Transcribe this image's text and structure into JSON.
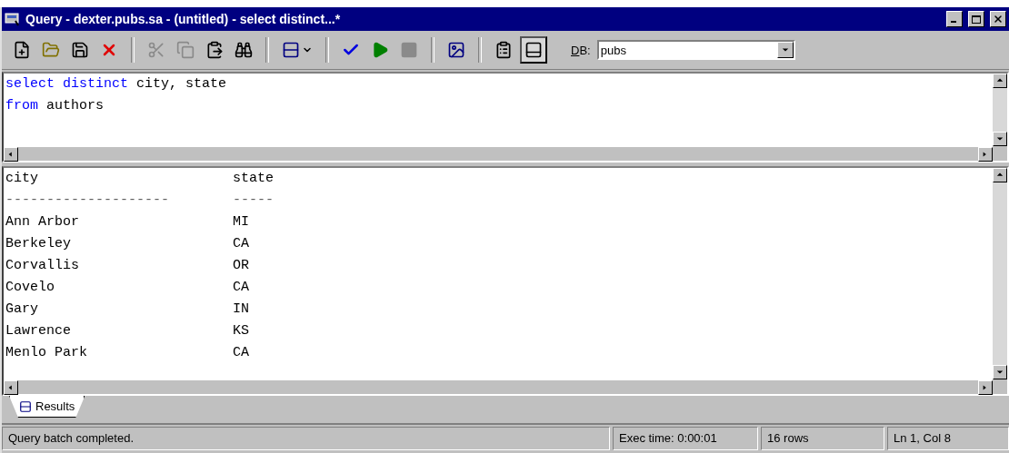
{
  "window": {
    "title": "Query - dexter.pubs.sa - (untitled) - select distinct...*"
  },
  "toolbar": {
    "groups": [
      [
        {
          "kind": "new",
          "disabled": false
        },
        {
          "kind": "open",
          "disabled": false
        },
        {
          "kind": "save",
          "disabled": false
        },
        {
          "kind": "delete",
          "disabled": false
        }
      ],
      [
        {
          "kind": "cut",
          "disabled": true
        },
        {
          "kind": "copy",
          "disabled": true
        },
        {
          "kind": "paste",
          "disabled": false
        },
        {
          "kind": "find",
          "disabled": false
        }
      ],
      [
        {
          "kind": "mode",
          "disabled": false
        }
      ],
      [
        {
          "kind": "parse",
          "disabled": false
        },
        {
          "kind": "execute",
          "disabled": false
        },
        {
          "kind": "stop",
          "disabled": true
        }
      ],
      [
        {
          "kind": "plan",
          "disabled": false
        }
      ],
      [
        {
          "kind": "options",
          "disabled": false
        },
        {
          "kind": "results-pane",
          "disabled": false,
          "pressed": true
        }
      ]
    ],
    "db_label": "DB:",
    "db_value": "pubs"
  },
  "editor": {
    "lines": [
      [
        {
          "kind": "keyword",
          "text": "select"
        },
        {
          "kind": "keyword",
          "text": "distinct"
        },
        {
          "kind": "plain",
          "text": "city, state"
        }
      ],
      [
        {
          "kind": "keyword",
          "text": "from"
        },
        {
          "kind": "plain",
          "text": "authors"
        }
      ]
    ]
  },
  "results": {
    "columns": [
      "city",
      "state"
    ],
    "dividers": [
      "--------------------",
      "-----"
    ],
    "rows": [
      [
        "Ann Arbor",
        "MI"
      ],
      [
        "Berkeley",
        "CA"
      ],
      [
        "Corvallis",
        "OR"
      ],
      [
        "Covelo",
        "CA"
      ],
      [
        "Gary",
        "IN"
      ],
      [
        "Lawrence",
        "KS"
      ],
      [
        "Menlo Park",
        "CA"
      ]
    ]
  },
  "tabs": [
    {
      "label": "Results",
      "selected": true
    }
  ],
  "status_bar": {
    "message": "Query batch completed.",
    "exec_time": "Exec time: 0:00:01",
    "rows": "16 rows",
    "position": "Ln 1, Col 8"
  }
}
